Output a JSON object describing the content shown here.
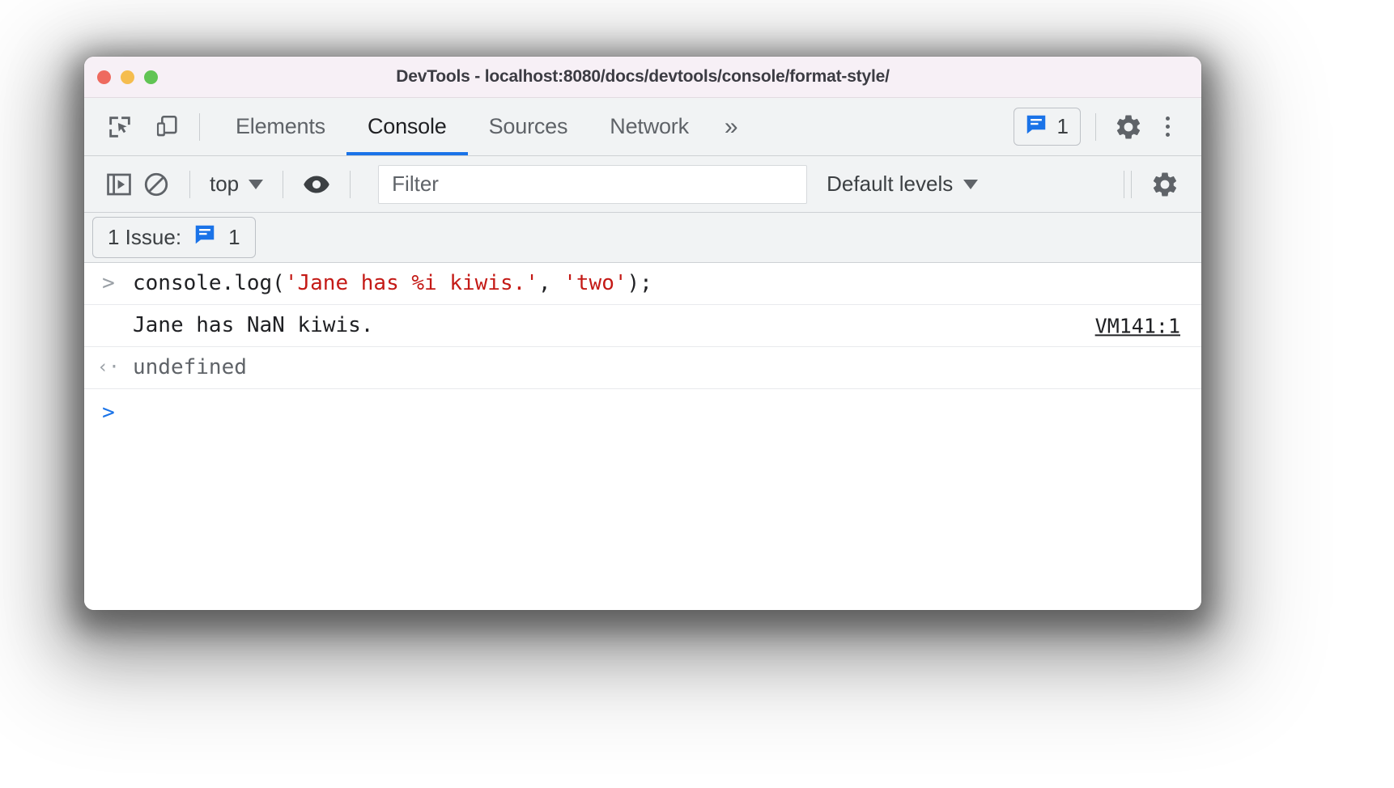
{
  "window": {
    "title": "DevTools - localhost:8080/docs/devtools/console/format-style/",
    "traffic_lights": [
      {
        "name": "close",
        "color": "#ee6a5f"
      },
      {
        "name": "minimize",
        "color": "#f5bd4f"
      },
      {
        "name": "maximize",
        "color": "#61c454"
      }
    ]
  },
  "tabbar": {
    "inspect_icon": "inspect-element-icon",
    "device_icon": "device-toolbar-icon",
    "tabs": [
      {
        "label": "Elements",
        "selected": false
      },
      {
        "label": "Console",
        "selected": true
      },
      {
        "label": "Sources",
        "selected": false
      },
      {
        "label": "Network",
        "selected": false
      }
    ],
    "more_tabs_label": "»",
    "issues_count": "1",
    "issues_icon": "issues-speech-bubble-icon",
    "settings_icon": "gear-icon",
    "more_options_icon": "kebab-menu-icon",
    "accent_color": "#1a73e8"
  },
  "console_toolbar": {
    "sidebar_toggle_icon": "console-sidebar-icon",
    "clear_console_icon": "clear-console-icon",
    "context_label": "top",
    "eye_icon": "live-expression-eye-icon",
    "filter_value": "",
    "filter_placeholder": "Filter",
    "levels_label": "Default levels",
    "settings_icon": "console-settings-gear-icon"
  },
  "issues_bar": {
    "label": "1 Issue:",
    "icon": "issues-speech-bubble-icon",
    "count": "1"
  },
  "console": {
    "rows": [
      {
        "type": "input",
        "gutter": ">",
        "segments": [
          {
            "text": "console.log(",
            "style": "plain"
          },
          {
            "text": "'Jane has %i kiwis.'",
            "style": "string"
          },
          {
            "text": ", ",
            "style": "plain"
          },
          {
            "text": "'two'",
            "style": "string"
          },
          {
            "text": ");",
            "style": "plain"
          }
        ],
        "source_link": ""
      },
      {
        "type": "output",
        "gutter": "",
        "segments": [
          {
            "text": "Jane has NaN kiwis.",
            "style": "plain"
          }
        ],
        "source_link": "VM141:1"
      },
      {
        "type": "result",
        "gutter": "‹·",
        "segments": [
          {
            "text": "undefined",
            "style": "muted"
          }
        ],
        "source_link": ""
      },
      {
        "type": "prompt",
        "gutter": ">",
        "segments": [],
        "source_link": ""
      }
    ]
  },
  "colors": {
    "accent": "#1a73e8",
    "string_literal": "#c41a16",
    "titlebar_bg": "#f7f0f6",
    "toolbar_bg": "#f1f3f4",
    "text": "#202124",
    "muted_text": "#5f6368"
  }
}
